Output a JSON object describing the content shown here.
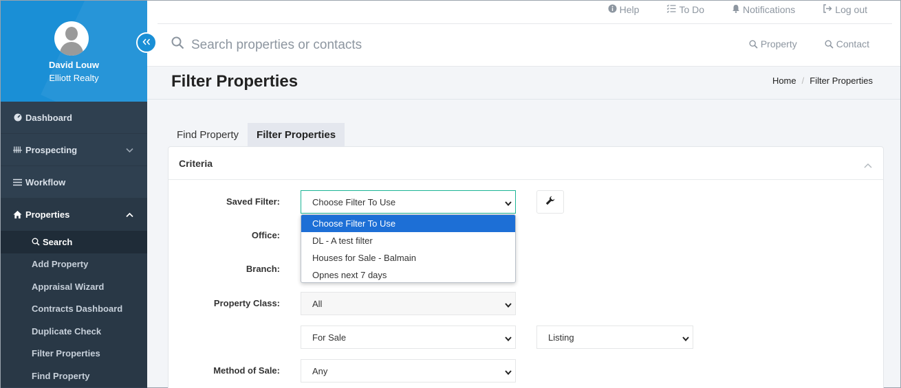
{
  "user": {
    "name": "David Louw",
    "company": "Elliott Realty"
  },
  "sidebar": {
    "items": [
      {
        "label": "Dashboard"
      },
      {
        "label": "Prospecting"
      },
      {
        "label": "Workflow"
      },
      {
        "label": "Properties"
      }
    ],
    "sub_items": [
      {
        "label": "Search"
      },
      {
        "label": "Add Property"
      },
      {
        "label": "Appraisal Wizard"
      },
      {
        "label": "Contracts Dashboard"
      },
      {
        "label": "Duplicate Check"
      },
      {
        "label": "Filter Properties"
      },
      {
        "label": "Find Property"
      }
    ]
  },
  "toplinks": {
    "help": "Help",
    "todo": "To Do",
    "notifications": "Notifications",
    "logout": "Log out"
  },
  "search": {
    "placeholder": "Search properties or contacts"
  },
  "quicklinks": {
    "property": "Property",
    "contact": "Contact"
  },
  "page": {
    "title": "Filter Properties",
    "breadcrumb_home": "Home",
    "breadcrumb_current": "Filter Properties"
  },
  "tabs": [
    {
      "label": "Find Property"
    },
    {
      "label": "Filter Properties"
    }
  ],
  "panel": {
    "title": "Criteria"
  },
  "form": {
    "saved_filter_label": "Saved Filter:",
    "saved_filter_value": "Choose Filter To Use",
    "office_label": "Office:",
    "branch_label": "Branch:",
    "property_class_label": "Property Class:",
    "property_class_value": "All",
    "sale_type_value": "For Sale",
    "listing_value": "Listing",
    "method_of_sale_label": "Method of Sale:",
    "method_of_sale_value": "Any"
  },
  "dropdown": {
    "options": [
      {
        "label": "Choose Filter To Use"
      },
      {
        "label": "DL - A test filter"
      },
      {
        "label": "Houses for Sale - Balmain"
      },
      {
        "label": "Opnes next 7 days"
      }
    ]
  },
  "colors": {
    "sidebar": "#2f4050",
    "accent": "#1a8fd6",
    "focus": "#1ab394",
    "selected_option": "#1d6fd6"
  },
  "icons": [
    "user-avatar-icon",
    "double-chevron-left-icon",
    "dashboard-icon",
    "prospecting-icon",
    "workflow-icon",
    "home-icon",
    "search-icon",
    "info-icon",
    "checklist-icon",
    "bell-icon",
    "logout-icon",
    "wrench-icon",
    "chevron-up-icon",
    "chevron-down-icon"
  ]
}
